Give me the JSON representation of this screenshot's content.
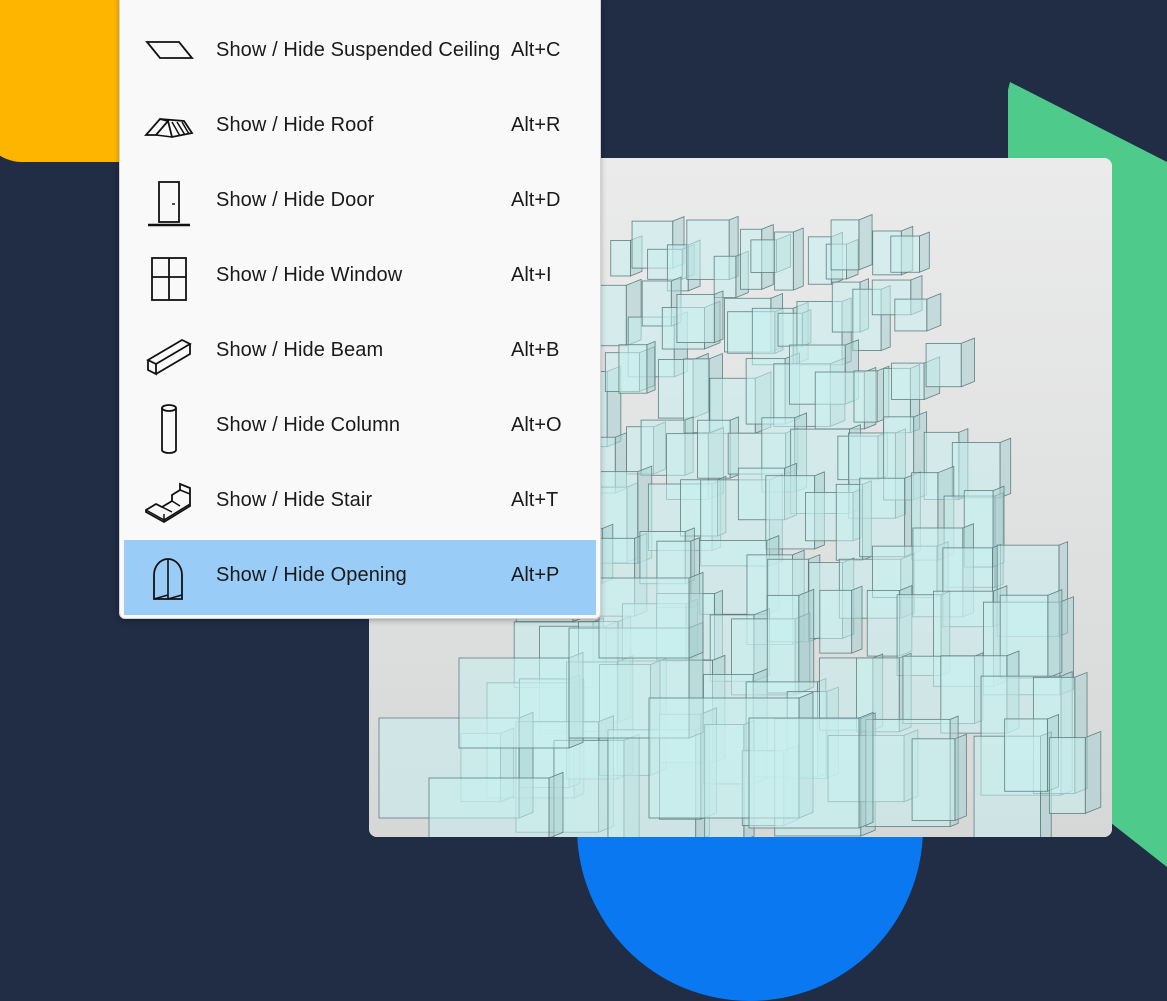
{
  "colors": {
    "background": "#212c45",
    "accent_yellow": "#fdb500",
    "accent_green": "#4ecb8a",
    "accent_blue": "#0a78f0",
    "menu_background": "#f9f9f9",
    "menu_selected": "#99ccf7",
    "glass_panel": "#c8eeee"
  },
  "menu": {
    "items": [
      {
        "label": "Show / Hide Suspended Ceiling",
        "shortcut": "Alt+C",
        "icon": "suspended-ceiling-icon"
      },
      {
        "label": "Show / Hide Roof",
        "shortcut": "Alt+R",
        "icon": "roof-icon"
      },
      {
        "label": "Show / Hide Door",
        "shortcut": "Alt+D",
        "icon": "door-icon"
      },
      {
        "label": "Show / Hide Window",
        "shortcut": "Alt+I",
        "icon": "window-icon"
      },
      {
        "label": "Show / Hide Beam",
        "shortcut": "Alt+B",
        "icon": "beam-icon"
      },
      {
        "label": "Show / Hide Column",
        "shortcut": "Alt+O",
        "icon": "column-icon"
      },
      {
        "label": "Show / Hide Stair",
        "shortcut": "Alt+T",
        "icon": "stair-icon"
      },
      {
        "label": "Show / Hide Opening",
        "shortcut": "Alt+P",
        "icon": "opening-icon",
        "selected": true
      }
    ]
  }
}
